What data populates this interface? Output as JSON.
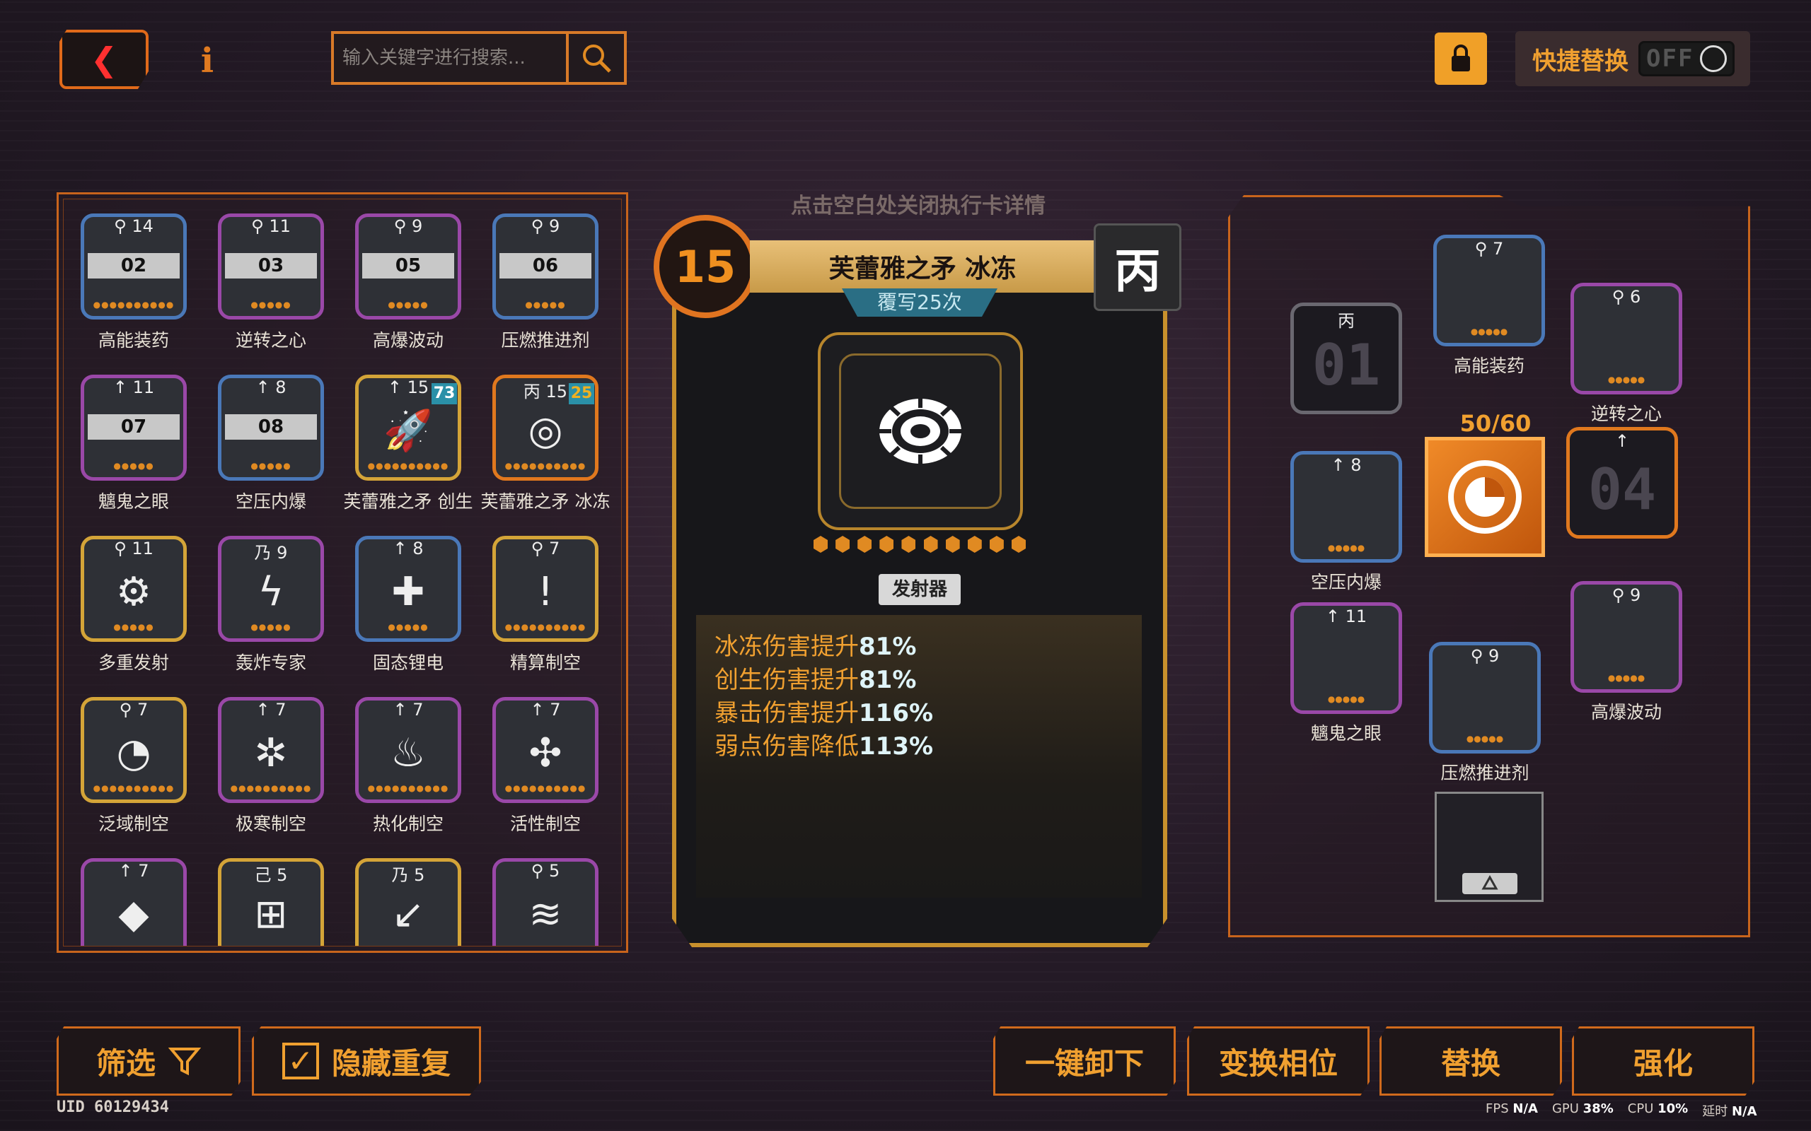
{
  "header": {
    "search_placeholder": "输入关键字进行搜索...",
    "quick_swap_label": "快捷替换",
    "quick_swap_state": "OFF"
  },
  "hint": "点击空白处关闭执行卡详情",
  "left_cards": [
    {
      "top": "⚲ 14",
      "band": "02",
      "label": "高能装药",
      "color": "blue",
      "dots": "●●●●●●●●●●"
    },
    {
      "top": "⚲ 11",
      "band": "03",
      "label": "逆转之心",
      "color": "purple",
      "dots": "●●●●●"
    },
    {
      "top": "⚲ 9",
      "band": "05",
      "label": "高爆波动",
      "color": "purple",
      "dots": "●●●●●"
    },
    {
      "top": "⚲ 9",
      "band": "06",
      "label": "压燃推进剂",
      "color": "blue",
      "dots": "●●●●●"
    },
    {
      "top": "↑ 11",
      "band": "07",
      "label": "魑鬼之眼",
      "color": "purple",
      "dots": "●●●●●"
    },
    {
      "top": "↑ 8",
      "band": "08",
      "label": "空压内爆",
      "color": "blue",
      "dots": "●●●●●"
    },
    {
      "top": "↑ 15",
      "badge": "73",
      "label": "芙蕾雅之矛 创生",
      "color": "gold",
      "icon": "🚀",
      "dots": "●●●●●●●●●●"
    },
    {
      "top": "丙 15",
      "badge": "25",
      "label": "芙蕾雅之矛 冰冻",
      "color": "orange",
      "icon": "◎",
      "dots": "●●●●●●●●●●"
    },
    {
      "top": "⚲ 11",
      "label": "多重发射",
      "color": "gold",
      "icon": "⚙",
      "dots": "●●●●●"
    },
    {
      "top": "乃 9",
      "label": "轰炸专家",
      "color": "purple",
      "icon": "ϟ",
      "dots": "●●●●●"
    },
    {
      "top": "↑ 8",
      "label": "固态锂电",
      "color": "blue",
      "icon": "✚",
      "dots": "●●●●●"
    },
    {
      "top": "⚲ 7",
      "label": "精算制空",
      "color": "gold",
      "icon": "!",
      "dots": "●●●●●●●●●●"
    },
    {
      "top": "⚲ 7",
      "label": "泛域制空",
      "color": "gold",
      "icon": "◔",
      "dots": "●●●●●●●●●●"
    },
    {
      "top": "↑ 7",
      "label": "极寒制空",
      "color": "purple",
      "icon": "✲",
      "dots": "●●●●●●●●●●"
    },
    {
      "top": "↑ 7",
      "label": "热化制空",
      "color": "purple",
      "icon": "♨",
      "dots": "●●●●●●●●●●"
    },
    {
      "top": "↑ 7",
      "label": "活性制空",
      "color": "purple",
      "icon": "✣",
      "dots": "●●●●●●●●●●"
    },
    {
      "top": "↑ 7",
      "label": "",
      "color": "purple",
      "icon": "◆"
    },
    {
      "top": "己 5",
      "label": "",
      "color": "gold",
      "icon": "⊞"
    },
    {
      "top": "乃 5",
      "label": "",
      "color": "gold",
      "icon": "↙"
    },
    {
      "top": "⚲ 5",
      "label": "",
      "color": "purple",
      "icon": "≋"
    }
  ],
  "detail": {
    "level": "15",
    "title": "芙蕾雅之矛 冰冻",
    "subtitle": "覆写25次",
    "rank": "丙",
    "type": "发射器",
    "stats": [
      {
        "k": "冰冻伤害提升",
        "v": "81%"
      },
      {
        "k": "创生伤害提升",
        "v": "81%"
      },
      {
        "k": "暴击伤害提升",
        "v": "116%"
      },
      {
        "k": "弱点伤害降低",
        "v": "113%"
      }
    ]
  },
  "right": {
    "energy": "50/60",
    "slot01": {
      "top": "丙",
      "big": "01"
    },
    "slot04": {
      "top": "↑",
      "big": "04"
    },
    "cards": [
      {
        "top": "⚲ 7",
        "label": "高能装药"
      },
      {
        "top": "⚲ 6",
        "label": "逆转之心"
      },
      {
        "top": "↑ 8",
        "label": "空压内爆"
      },
      {
        "top": "↑ 11",
        "label": "魑鬼之眼"
      },
      {
        "top": "⚲ 9",
        "label": "压燃推进剂"
      },
      {
        "top": "⚲ 9",
        "label": "高爆波动"
      }
    ]
  },
  "bottom": {
    "filter": "筛选",
    "hide_dup": "隐藏重复",
    "unload_all": "一键卸下",
    "swap_phase": "变换相位",
    "replace": "替换",
    "enhance": "强化",
    "uid": "UID 60129434",
    "fps_label": "FPS",
    "fps": "N/A",
    "gpu_label": "GPU",
    "gpu": "38%",
    "cpu_label": "CPU",
    "cpu": "10%",
    "latency_label": "延时",
    "latency": "N/A"
  },
  "colors": {
    "accent": "#e07420",
    "gold": "#f0a030",
    "teal": "#2a90a8"
  }
}
